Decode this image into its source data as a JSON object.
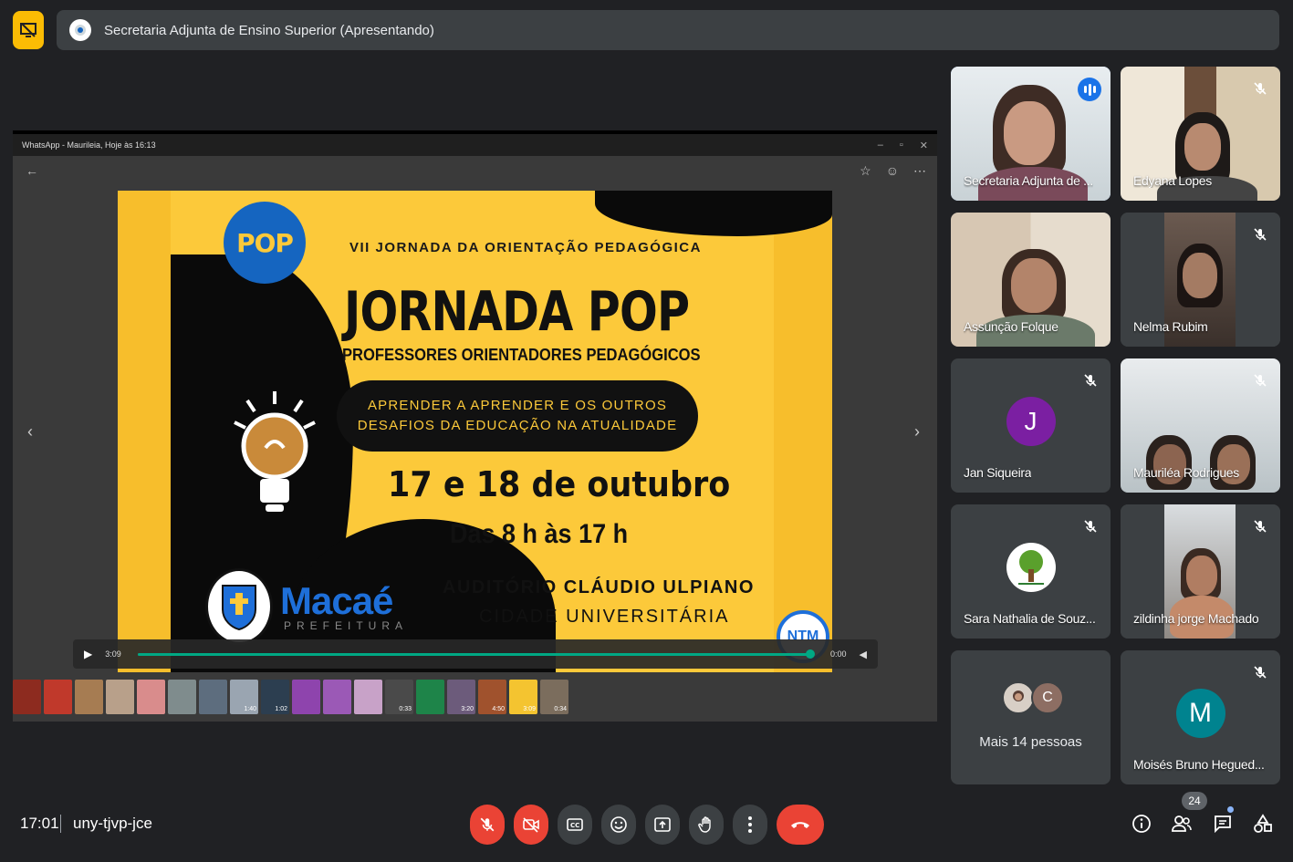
{
  "presenting": {
    "title": "Secretaria Adjunta de Ensino Superior (Apresentando)"
  },
  "shared_window": {
    "title": "WhatsApp - Maurileia, Hoje às 16:13",
    "poster": {
      "logo_text": "POP",
      "edition": "VII JORNADA DA ORIENTAÇÃO PEDAGÓGICA",
      "title": "JORNADA POP",
      "subtitle": "PROFESSORES ORIENTADORES PEDAGÓGICOS",
      "theme_line1": "APRENDER A APRENDER E OS OUTROS",
      "theme_line2": "DESAFIOS DA EDUCAÇÃO NA ATUALIDADE",
      "date": "17 e 18 de outubro",
      "hours": "Das 8 h às 17 h",
      "venue_line1": "AUDITÓRIO CLÁUDIO ULPIANO",
      "venue_line2": "CIDADE UNIVERSITÁRIA",
      "org_name": "Macaé",
      "org_sub": "PREFEITURA",
      "badge": "NTM"
    },
    "video": {
      "current": "3:09",
      "remaining": "0:00",
      "progress": 0.995
    },
    "thumbnails": [
      {
        "color": "#8d2b1f",
        "label": ""
      },
      {
        "color": "#c0392b",
        "label": ""
      },
      {
        "color": "#a67c52",
        "label": ""
      },
      {
        "color": "#b8a08a",
        "label": ""
      },
      {
        "color": "#d98c8c",
        "label": ""
      },
      {
        "color": "#7f8c8d",
        "label": ""
      },
      {
        "color": "#5d6d7e",
        "label": ""
      },
      {
        "color": "#9aa5b1",
        "label": "1:40"
      },
      {
        "color": "#2c3e50",
        "label": "1:02"
      },
      {
        "color": "#8e44ad",
        "label": ""
      },
      {
        "color": "#9b59b6",
        "label": ""
      },
      {
        "color": "#c8a2c8",
        "label": ""
      },
      {
        "color": "#4a4a4a",
        "label": "0:33"
      },
      {
        "color": "#1e8449",
        "label": ""
      },
      {
        "color": "#6c5b7b",
        "label": "3:20"
      },
      {
        "color": "#a0522d",
        "label": "4:50"
      },
      {
        "color": "#f4c430",
        "label": "3:09"
      },
      {
        "color": "#7b6d5d",
        "label": "0:34"
      }
    ]
  },
  "participants": [
    {
      "name": "Secretaria Adjunta de ...",
      "state": "speaking",
      "bg": "#cfd8dc"
    },
    {
      "name": "Edyana Lopes",
      "state": "muted",
      "bg": "#8d7b6a"
    },
    {
      "name": "Assunção Folque",
      "state": "none",
      "bg": "#a1887f"
    },
    {
      "name": "Nelma Rubim",
      "state": "muted",
      "bg": "#5d4e45"
    },
    {
      "name": "Jan Siqueira",
      "state": "muted",
      "initial": "J",
      "avatar_color": "#7b1fa2"
    },
    {
      "name": "Mauriléa Rodrigues",
      "state": "muted",
      "bg": "#b0bec5"
    },
    {
      "name": "Sara Nathalia de Souz...",
      "state": "muted",
      "avatar_color": "#ffffff"
    },
    {
      "name": "zildinha jorge Machado",
      "state": "muted",
      "bg": "#9e9e9e"
    },
    {
      "name": "Moisés Bruno Hegued...",
      "state": "muted",
      "initial": "M",
      "avatar_color": "#00838f"
    }
  ],
  "more_people": {
    "label": "Mais 14 pessoas",
    "second_initial": "C"
  },
  "meeting": {
    "time": "17:01",
    "code": "uny-tjvp-jce",
    "participant_count": "24"
  }
}
